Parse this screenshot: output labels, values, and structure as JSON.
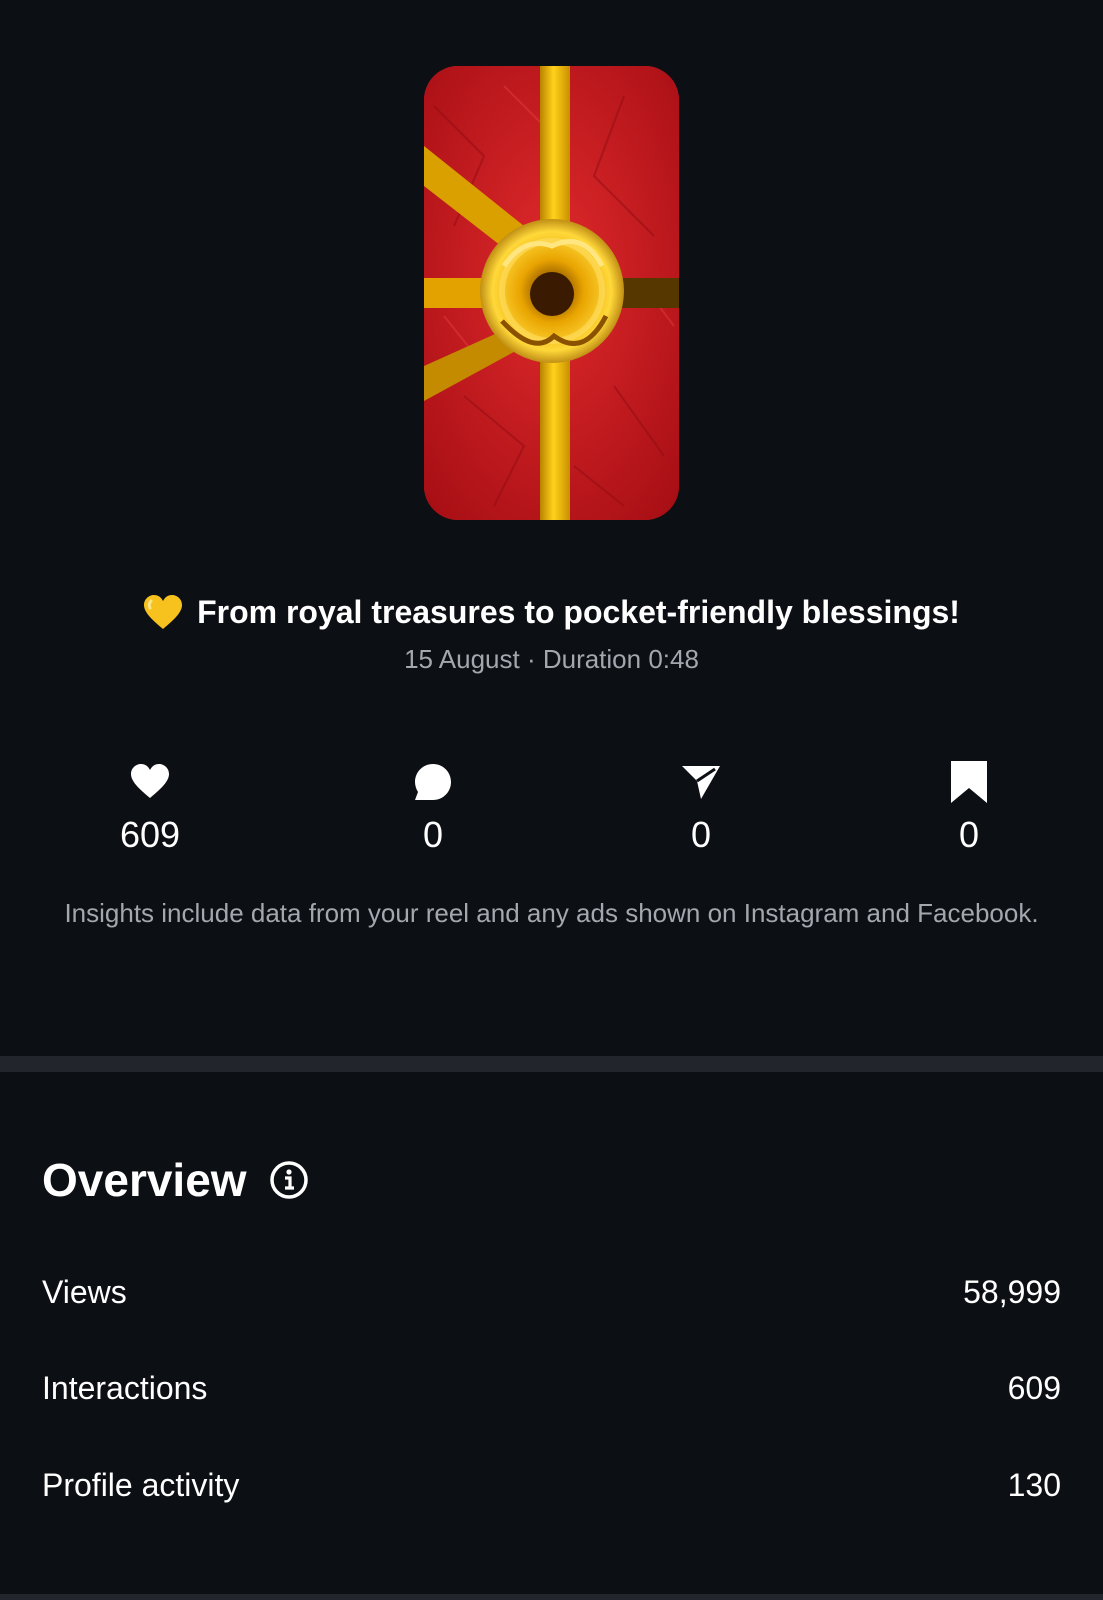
{
  "reel": {
    "caption_emoji": "yellow-heart-emoji",
    "caption": "From royal treasures to pocket-friendly blessings!",
    "date": "15 August",
    "duration": "Duration 0:48"
  },
  "stats": {
    "likes": "609",
    "comments": "0",
    "shares": "0",
    "saves": "0"
  },
  "note": "Insights include data from your reel and any ads shown on Instagram and Facebook.",
  "overview": {
    "title": "Overview",
    "rows": [
      {
        "label": "Views",
        "value": "58,999"
      },
      {
        "label": "Interactions",
        "value": "609"
      },
      {
        "label": "Profile activity",
        "value": "130"
      }
    ]
  },
  "colors": {
    "background": "#0c0f14",
    "secondary_text": "#a3a7ae",
    "divider": "#22262c",
    "thumb_red": "#c8161c",
    "ribbon_gold": "#f2b705"
  }
}
